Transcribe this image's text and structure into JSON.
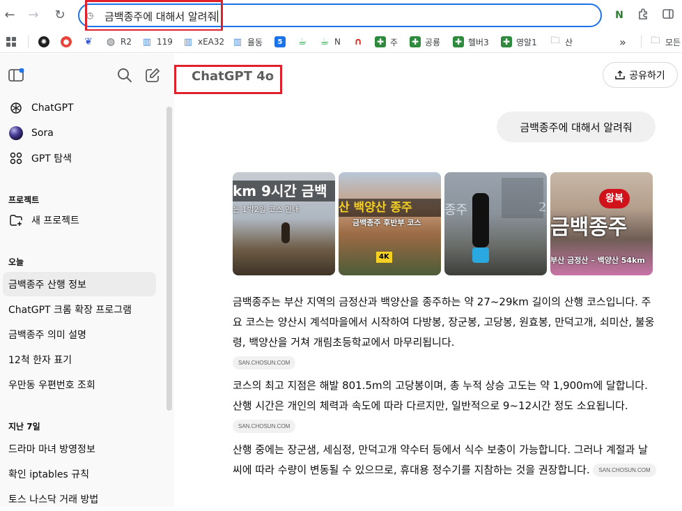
{
  "browser": {
    "omnibox_text": "금백종주에 대해서 알려줘",
    "bookmarks": [
      {
        "label": "",
        "icon": "openai-icon",
        "color": "#1f1f1f"
      },
      {
        "label": "",
        "icon": "red-circle-icon",
        "color": "#e8453c"
      },
      {
        "label": "",
        "icon": "blue-wing-icon",
        "color": "#3b5bdb"
      },
      {
        "label": "R2",
        "icon": "globe-icon",
        "color": "#5f6368"
      },
      {
        "label": "119",
        "icon": "chart-icon",
        "color": "#4a89dc"
      },
      {
        "label": "xEA32",
        "icon": "chart-icon",
        "color": "#4a89dc"
      },
      {
        "label": "율동",
        "icon": "chart-icon",
        "color": "#4a89dc"
      },
      {
        "label": "",
        "icon": "number-five-icon",
        "color": "#1a73e8"
      },
      {
        "label": "",
        "icon": "cup-icon",
        "color": "#2da94f"
      },
      {
        "label": "N",
        "icon": "cup-icon",
        "color": "#2da94f"
      },
      {
        "label": "",
        "icon": "arch-icon",
        "color": "#d93025"
      },
      {
        "label": "주",
        "icon": "cross-icon",
        "color": "#2e8b3d"
      },
      {
        "label": "공룡",
        "icon": "cross-icon",
        "color": "#2e8b3d"
      },
      {
        "label": "헬버3",
        "icon": "cross-icon",
        "color": "#2e8b3d"
      },
      {
        "label": "영알1",
        "icon": "cross-icon",
        "color": "#2e8b3d"
      },
      {
        "label": "산",
        "icon": "folder-icon",
        "color": "#5f6368"
      }
    ],
    "more_label": "»",
    "other_folder_label": "모든"
  },
  "sidebar": {
    "nav": [
      {
        "label": "ChatGPT",
        "icon": "openai-icon"
      },
      {
        "label": "Sora",
        "icon": "sora-icon"
      },
      {
        "label": "GPT 탐색",
        "icon": "grid-icon"
      }
    ],
    "projects_heading": "프로젝트",
    "new_project": "새 프로젝트",
    "today_heading": "오늘",
    "today": [
      "금백종주 산행 정보",
      "ChatGPT 크롬 확장 프로그램",
      "금백종주 의미 설명",
      "12척 한자 표기",
      "우만동 우편번호 조회"
    ],
    "week_heading": "지난 7일",
    "week": [
      "드라마 마녀 방영정보",
      "확인 iptables 규칙",
      "토스 나스닥 거래 방법"
    ]
  },
  "main": {
    "model": "ChatGPT 4o",
    "share": "공유하기",
    "user_message": "금백종주에 대해서 알려줘",
    "thumbnails": [
      {
        "caption": "km 9시간 금백",
        "sub": "는 1박2일 코스 안내"
      },
      {
        "caption": "산 백양산 종주",
        "sub": "금백종주 후반부 코스",
        "badge": "4K"
      },
      {
        "caption": "종주",
        "sub": "2"
      },
      {
        "caption": "금백종주",
        "sub": "부산 금정산 – 백양산 54km",
        "badge": "왕복"
      }
    ],
    "paragraphs": [
      {
        "text": "금백종주는 부산 지역의 금정산과 백양산을 종주하는 약 27~29km 길이의 산행 코스입니다. 주요 코스는 양산시 계석마을에서 시작하여 다방봉, 장군봉, 고당봉, 원효봉, 만덕고개, 쇠미산, 불웅령, 백양산을 거쳐 개림초등학교에서 마무리됩니다.",
        "cite": "SAN.CHOSUN.COM"
      },
      {
        "text": "코스의 최고 지점은 해발 801.5m의 고당봉이며, 총 누적 상승 고도는 약 1,900m에 달합니다. 산행 시간은 개인의 체력과 속도에 따라 다르지만, 일반적으로 9~12시간 정도 소요됩니다.",
        "cite": "SAN.CHOSUN.COM"
      },
      {
        "text": "산행 중에는 장군샘, 세심정, 만덕고개 약수터 등에서 식수 보충이 가능합니다. 그러나 계절과 날씨에 따라 수량이 변동될 수 있으므로, 휴대용 정수기를 지참하는 것을 권장합니다.",
        "cite": "SAN.CHOSUN.COM"
      }
    ]
  }
}
